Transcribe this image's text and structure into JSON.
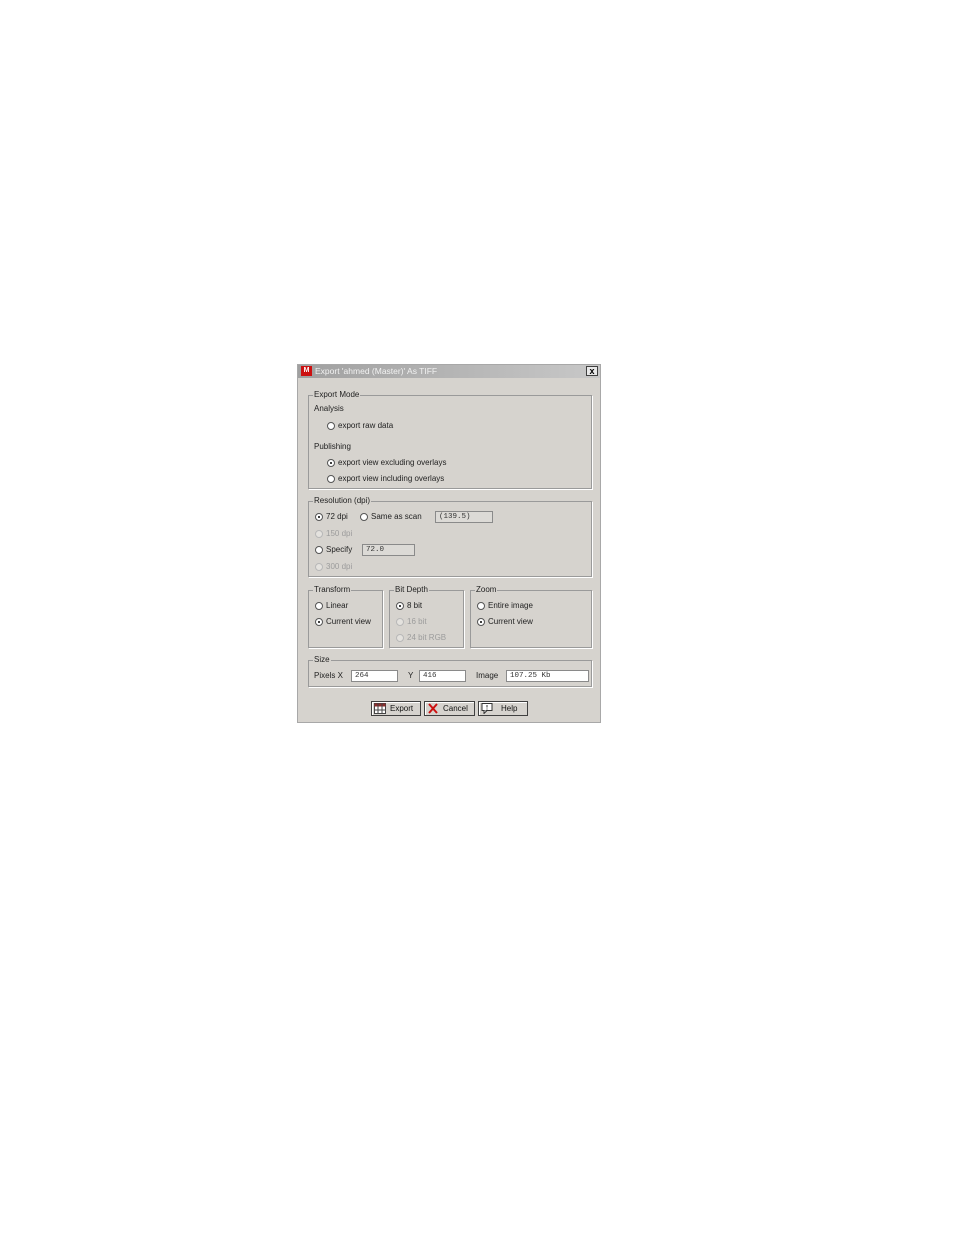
{
  "dialog": {
    "title": "Export 'ahmed (Master)' As TIFF",
    "app_icon": "app-logo-icon",
    "close_label": "x"
  },
  "export_mode": {
    "legend": "Export Mode",
    "analysis_label": "Analysis",
    "raw_data_label": "export raw data",
    "publishing_label": "Publishing",
    "excluding_label": "export view excluding overlays",
    "including_label": "export view including overlays",
    "selected": "export view excluding overlays"
  },
  "resolution": {
    "legend": "Resolution (dpi)",
    "dpi72_label": "72 dpi",
    "same_as_scan_label": "Same as scan",
    "scan_value": "(139.5)",
    "dpi150_label": "150 dpi",
    "specify_label": "Specify",
    "specify_value": "72.0",
    "dpi300_label": "300 dpi",
    "selected": "72 dpi"
  },
  "transform": {
    "legend": "Transform",
    "linear_label": "Linear",
    "current_view_label": "Current view",
    "selected": "Current view"
  },
  "bit_depth": {
    "legend": "Bit Depth",
    "bit8_label": "8 bit",
    "bit16_label": "16 bit",
    "bit24_label": "24 bit RGB",
    "selected": "8 bit"
  },
  "zoom": {
    "legend": "Zoom",
    "entire_label": "Entire image",
    "current_view_label": "Current view",
    "selected": "Current view"
  },
  "size": {
    "legend": "Size",
    "pixels_x_label": "Pixels X",
    "x_value": "264",
    "y_label": "Y",
    "y_value": "416",
    "image_label": "Image",
    "image_value": "107.25 Kb"
  },
  "buttons": {
    "export_label": "Export",
    "cancel_label": "Cancel",
    "help_label": "Help"
  },
  "colors": {
    "dialog_bg": "#d6d3ce",
    "cancel_x": "#cc1010"
  }
}
